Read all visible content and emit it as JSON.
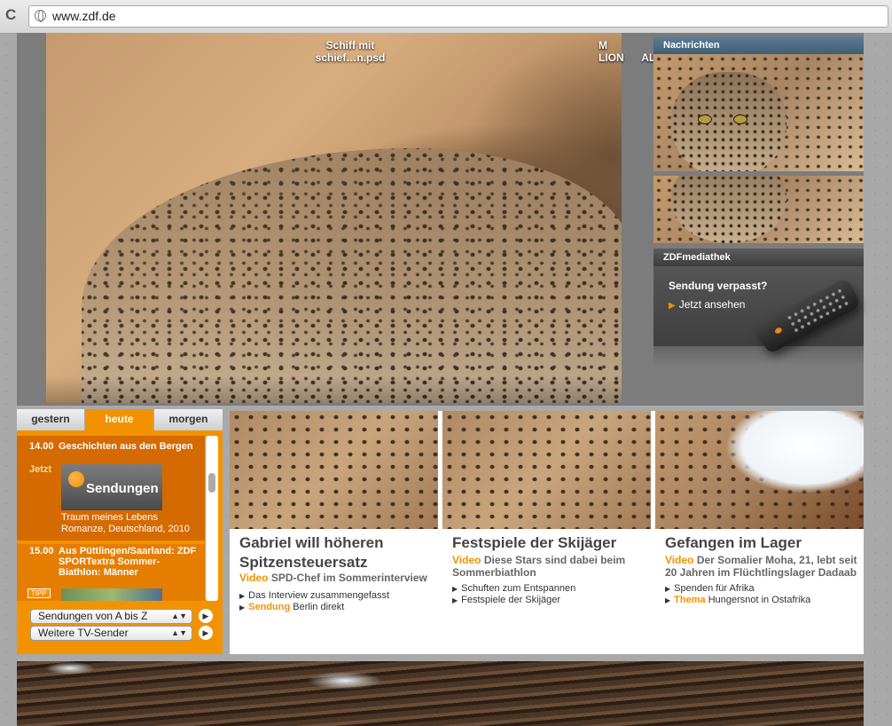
{
  "browser": {
    "url": "www.zdf.de"
  },
  "desktop_labels": [
    {
      "text": "Schiff mit\nschief…n.psd"
    },
    {
      "text": "M\nLION      ALL"
    }
  ],
  "right": {
    "news_header": "Nachrichten",
    "media_header": "ZDFmediathek",
    "media_title": "Sendung verpasst?",
    "media_link": "Jetzt ansehen"
  },
  "tv": {
    "tabs": [
      "gestern",
      "heute",
      "morgen"
    ],
    "items": [
      {
        "time": "14.00",
        "title": "Geschichten aus den Bergen",
        "now_label": "Jetzt",
        "thumb_label": "Sendungen",
        "desc": "Traum meines Lebens Romanze, Deutschland, 2010"
      },
      {
        "time": "15.00",
        "title": "Aus Püttlingen/Saarland: ZDF SPORTextra Sommer-Biathlon: Männer",
        "badge": "TIPP"
      }
    ],
    "selects": [
      {
        "value": "Sendungen von A bis Z"
      },
      {
        "value": "Weitere TV-Sender"
      }
    ]
  },
  "teasers": [
    {
      "title": "Gabriel will höheren Spitzensteuersatz",
      "kind": "Video",
      "sub": "SPD-Chef im Sommerinterview",
      "links": [
        {
          "prefix": "",
          "text": "Das Interview zusammengefasst"
        },
        {
          "prefix": "Sendung",
          "text": "Berlin direkt"
        }
      ]
    },
    {
      "title": "Festspiele der Skijäger",
      "kind": "Video",
      "sub": "Diese Stars sind dabei beim Sommerbiathlon",
      "links": [
        {
          "prefix": "",
          "text": "Schuften zum Entspannen"
        },
        {
          "prefix": "",
          "text": "Festspiele der Skijäger"
        }
      ]
    },
    {
      "title": "Gefangen im Lager",
      "kind": "Video",
      "sub": "Der Somalier Moha, 21, lebt seit 20 Jahren im Flüchtlingslager Dadaab",
      "links": [
        {
          "prefix": "",
          "text": "Spenden für Afrika"
        },
        {
          "prefix": "Thema",
          "text": "Hungersnot in Ostafrika"
        }
      ]
    }
  ],
  "colors": {
    "accent": "#f39200",
    "news_header": "#3f5f77",
    "media_header": "#3c3c3c"
  }
}
